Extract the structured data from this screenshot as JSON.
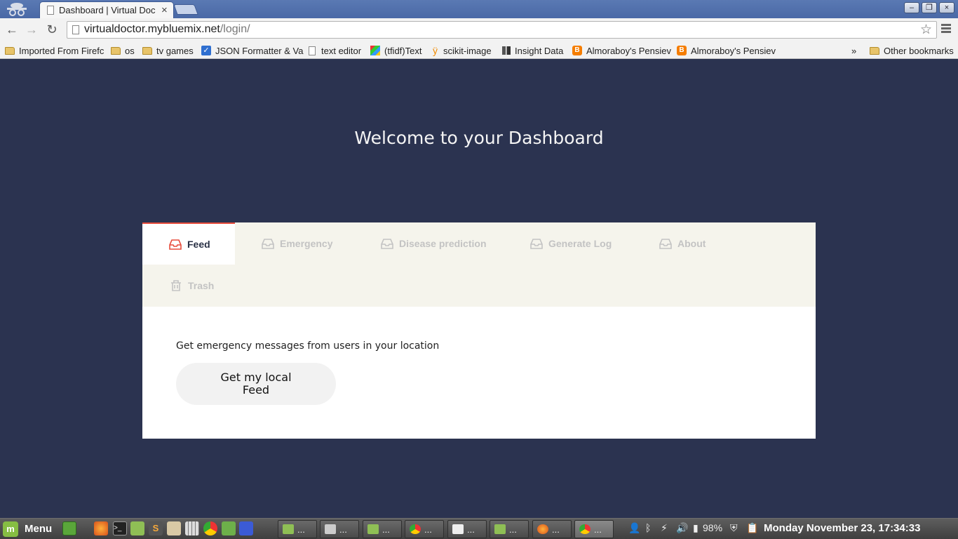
{
  "browser": {
    "tab_title": "Dashboard | Virtual Doc",
    "tab_close": "×",
    "url_host": "virtualdoctor.mybluemix.net",
    "url_path": "/login/",
    "back": "←",
    "forward": "→",
    "reload": "↻",
    "star": "☆",
    "minimize": "–",
    "maximize": "❐",
    "close": "×"
  },
  "bookmarks": {
    "items": [
      {
        "label": "Imported From Firefc",
        "icon": "folder-icon"
      },
      {
        "label": "os",
        "icon": "folder-icon"
      },
      {
        "label": "tv games",
        "icon": "folder-icon"
      },
      {
        "label": "JSON Formatter & Va",
        "icon": "checkbox-icon"
      },
      {
        "label": "text editor",
        "icon": "document-icon"
      },
      {
        "label": "(tfidf)Text",
        "icon": "colorful-icon"
      },
      {
        "label": "scikit-image",
        "icon": "scikit-icon"
      },
      {
        "label": "Insight Data",
        "icon": "bars-icon"
      },
      {
        "label": "Almoraboy's Pensiev",
        "icon": "blogger-icon"
      },
      {
        "label": "Almoraboy's Pensiev",
        "icon": "blogger-icon"
      }
    ],
    "overflow": "»",
    "other": "Other bookmarks"
  },
  "page": {
    "heading": "Welcome to your Dashboard",
    "tabs": [
      {
        "label": "Feed",
        "icon": "inbox-icon",
        "active": true
      },
      {
        "label": "Emergency",
        "icon": "inbox-icon",
        "active": false
      },
      {
        "label": "Disease prediction",
        "icon": "inbox-icon",
        "active": false
      },
      {
        "label": "Generate Log",
        "icon": "inbox-icon",
        "active": false
      },
      {
        "label": "About",
        "icon": "inbox-icon",
        "active": false
      },
      {
        "label": "Trash",
        "icon": "trash-icon",
        "active": false
      }
    ],
    "description": "Get emergency messages from users in your location",
    "button_label": "Get my local Feed"
  },
  "taskbar": {
    "menu_label": "Menu",
    "window_ellipsis": "...",
    "battery": "98%",
    "clock": "Monday November 23, 17:34:33"
  },
  "colors": {
    "background": "#2b3350",
    "accent": "#e74c3c",
    "tabbar": "#f5f4ec"
  }
}
